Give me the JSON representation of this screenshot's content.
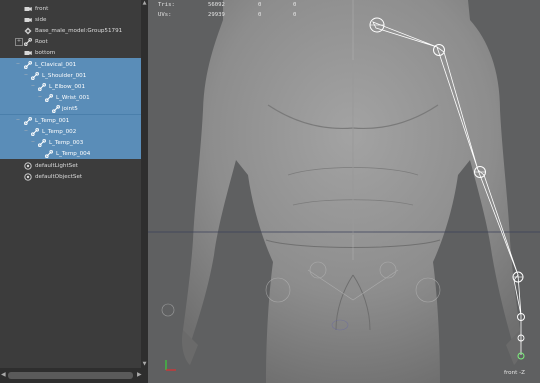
{
  "outliner": {
    "items": [
      {
        "label": "front",
        "icon": "camera-icon"
      },
      {
        "label": "side",
        "icon": "camera-icon"
      },
      {
        "label": "Base_male_model:Group51791",
        "icon": "transform-group-icon"
      },
      {
        "label": "Root",
        "icon": "joint-icon"
      },
      {
        "label": "bottom",
        "icon": "camera-icon"
      },
      {
        "label": "L_Clavical_001",
        "icon": "joint-icon"
      },
      {
        "label": "L_Shoulder_001",
        "icon": "joint-icon"
      },
      {
        "label": "L_Elbow_001",
        "icon": "joint-icon"
      },
      {
        "label": "L_Wrist_001",
        "icon": "joint-icon"
      },
      {
        "label": "joint5",
        "icon": "joint-icon"
      },
      {
        "label": "L_Temp_001",
        "icon": "joint-icon"
      },
      {
        "label": "L_Temp_002",
        "icon": "joint-icon"
      },
      {
        "label": "L_Temp_003",
        "icon": "joint-icon"
      },
      {
        "label": "L_Temp_004",
        "icon": "joint-icon"
      },
      {
        "label": "defaultLightSet",
        "icon": "set-icon"
      },
      {
        "label": "defaultObjectSet",
        "icon": "set-icon"
      }
    ]
  },
  "viewport": {
    "hud": {
      "tris_label": "Tris:",
      "tris_values": [
        "56092",
        "0",
        "0"
      ],
      "uvs_label": "UVs:",
      "uvs_values": [
        "29939",
        "0",
        "0"
      ]
    },
    "camera_label": "front -Z"
  },
  "colors": {
    "outliner_bg": "#3c3c3c",
    "selection": "#5a8db8",
    "viewport_bg": "#5f6061",
    "joint": "#ffffff"
  }
}
